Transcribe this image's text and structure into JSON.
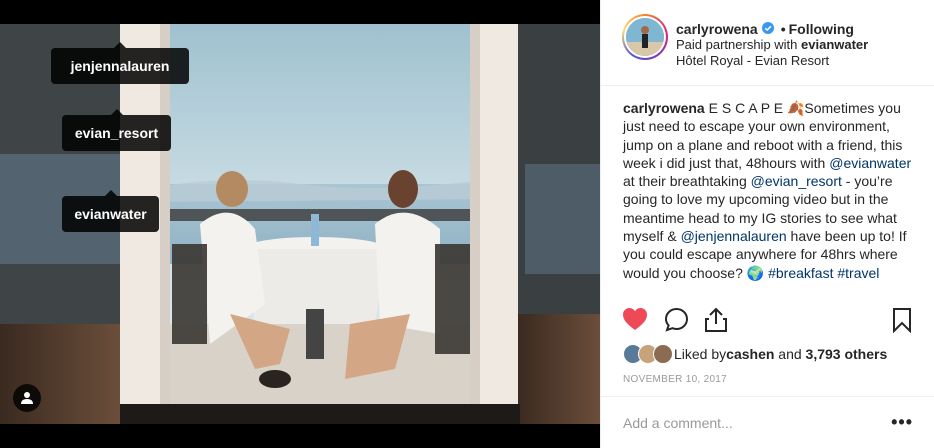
{
  "tags": [
    "jenjennalauren",
    "evian_resort",
    "evianwater"
  ],
  "post": {
    "username": "carlyrowena",
    "follow_dot": "•",
    "follow_status": "Following",
    "partnership_prefix": "Paid partnership with ",
    "partner": "evianwater",
    "location": "Hôtel Royal - Evian Resort"
  },
  "caption": {
    "username": "carlyrowena",
    "t1": " E S C A P E ",
    "emoji1": "🍂",
    "t2": "Sometimes you just need to escape your own environment, jump on a plane and reboot with a friend, this week i did just that, 48hours with ",
    "m1": "@evianwater",
    "t3": " at their breathtaking ",
    "m2": "@evian_resort",
    "t4": " - you’re going to love my upcoming video but in the meantime head to my IG stories to see what myself & ",
    "m3": "@jenjennalauren",
    "t5": " have been up to! If you could escape anywhere for 48hrs where would you choose? ",
    "emoji2": "🌍",
    "h1": "#breakfast",
    "space": " ",
    "h2": "#travel"
  },
  "likes": {
    "prefix": "Liked by ",
    "liker": "cashen",
    "middle": " and ",
    "count": "3,793 others"
  },
  "date": "November 10, 2017",
  "comment": {
    "placeholder": "Add a comment...",
    "more": "•••"
  },
  "colors": {
    "heart": "#ed4956",
    "link": "#003569",
    "verified": "#3897f0"
  }
}
